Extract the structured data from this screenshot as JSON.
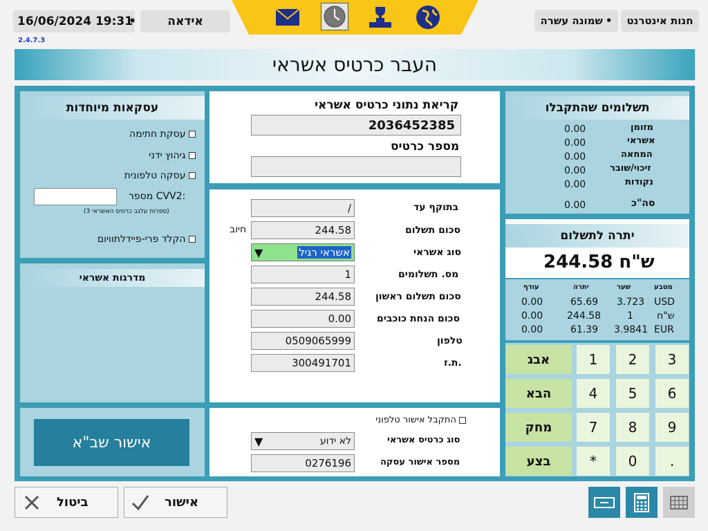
{
  "header": {
    "datetime": "16/06/2024  19:31",
    "user": "אידאה",
    "store": "חנות אינטרנט",
    "station": "שמונה עשרה",
    "version": "2.4.7.3"
  },
  "toolbar": {
    "icons": [
      "mail-icon",
      "clock-icon",
      "trophy-icon",
      "globe-icon"
    ]
  },
  "title": "העבר כרטיס אשראי",
  "special": {
    "title": "עסקאות מיוחדות",
    "opt1": "עסקת חתימה",
    "opt2": "גיהוץ ידני",
    "opt3": "עסקה טלפונית",
    "cvv_label": "מספר CVV2:",
    "cvv_value": "",
    "cvv_hint": "(3 ספרות עלגב כרטיס האשראי)",
    "freetype": "הקלד פרי-פיידלתוויום"
  },
  "levels": {
    "title": "מדרגות אשראי"
  },
  "approve_sba": "אישור שב\"א",
  "card": {
    "read_label": "קריאת נתוני כרטיס אשראי",
    "read_value": "2036452385",
    "number_label": "מספר כרטיס",
    "number_value": ""
  },
  "form": {
    "valid_label": "בתוקף עד",
    "valid_value": "/",
    "amount_label": "סכום תשלום",
    "amount_value": "244.58",
    "debit": "חיוב",
    "type_label": "סוג אשראי",
    "type_value": "אשראי רגיל",
    "count_label": "מס. תשלומים",
    "count_value": "1",
    "first_label": "סכום תשלום ראשון",
    "first_value": "244.58",
    "stars_label": "סכום הנחת כוכבים",
    "stars_value": "0.00",
    "phone_label": "טלפון",
    "phone_value": "0509065999",
    "id_label": "ת.ז.",
    "id_value": "300491701"
  },
  "phone_approval": {
    "checkbox": "התקבל אישור טלפוני",
    "cardtype_label": "סוג כרטיס אשראי",
    "cardtype_value": "לא ידוע",
    "approval_label": "מספר אישור עסקה",
    "approval_value": "0276196"
  },
  "received": {
    "title": "תשלומים שהתקבלו",
    "rows": [
      {
        "label": "מזומן",
        "value": "0.00"
      },
      {
        "label": "אשראי",
        "value": "0.00"
      },
      {
        "label": "המחאה",
        "value": "0.00"
      },
      {
        "label": "זיכוי/שובר",
        "value": "0.00"
      },
      {
        "label": "נקודות",
        "value": "0.00"
      }
    ],
    "total_label": "סה\"כ",
    "total_value": "0.00"
  },
  "balance": {
    "title": "יתרה לתשלום",
    "amount": "244.58 ש\"ח"
  },
  "currency": {
    "headers": [
      "מטבע",
      "שער",
      "יתרה",
      "עודף"
    ],
    "rows": [
      [
        "USD",
        "3.723",
        "65.69",
        "0.00"
      ],
      [
        "ש\"ח",
        "1",
        "244.58",
        "0.00"
      ],
      [
        "EUR",
        "3.9841",
        "61.39",
        "0.00"
      ]
    ]
  },
  "keypad": {
    "keys": [
      "3",
      "2",
      "1",
      "6",
      "5",
      "4",
      "9",
      "8",
      "7",
      ".",
      "0",
      "*"
    ],
    "abc": "אבג",
    "next": "הבא",
    "del": "מחק",
    "exec": "בצע"
  },
  "footer": {
    "cancel": "ביטול",
    "ok": "אישור"
  }
}
